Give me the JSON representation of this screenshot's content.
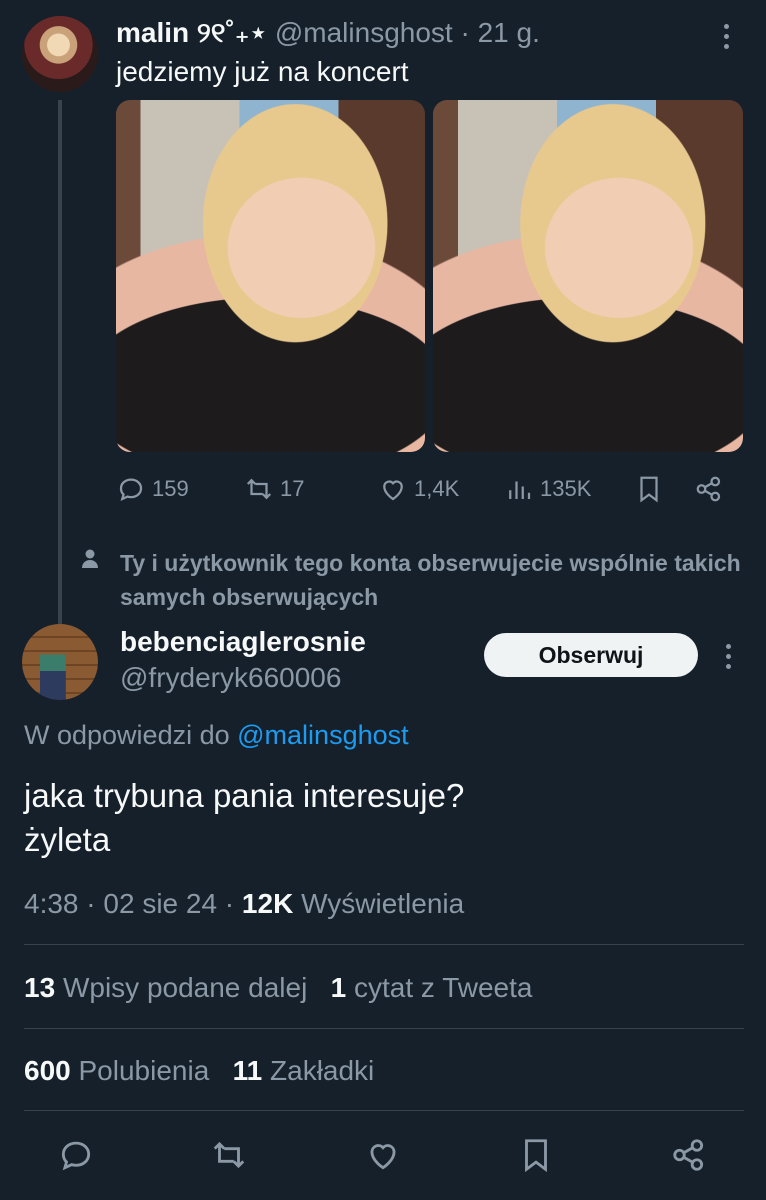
{
  "tweet": {
    "author_name": "malin ୨୧˚₊⋆",
    "author_handle": "@malinsghost",
    "time_ago": "21 g.",
    "text": "jedziemy już na koncert",
    "stats": {
      "replies": "159",
      "retweets": "17",
      "likes": "1,4K",
      "views": "135K"
    }
  },
  "mutual_notice": "Ty i użytkownik tego konta obserwujecie wspólnie takich samych obserwujących",
  "reply": {
    "author_name": "bebenciaglerosnie",
    "author_handle": "@fryderyk660006",
    "follow_label": "Obserwuj",
    "reply_prefix": "W odpowiedzi do",
    "reply_target": "@malinsghost",
    "text": "jaka trybuna pania interesuje?\nżyleta",
    "time": "4:38",
    "date": "02 sie 24",
    "views_count": "12K",
    "views_label": "Wyświetlenia",
    "retweets_count": "13",
    "retweets_label": "Wpisy podane dalej",
    "quotes_count": "1",
    "quotes_label": "cytat z Tweeta",
    "likes_count": "600",
    "likes_label": "Polubienia",
    "bookmarks_count": "11",
    "bookmarks_label": "Zakładki"
  },
  "colors": {
    "background": "#15202b",
    "text": "#f7f9f9",
    "muted": "#8b98a5",
    "link": "#1d9bf0",
    "divider": "#38444d"
  }
}
